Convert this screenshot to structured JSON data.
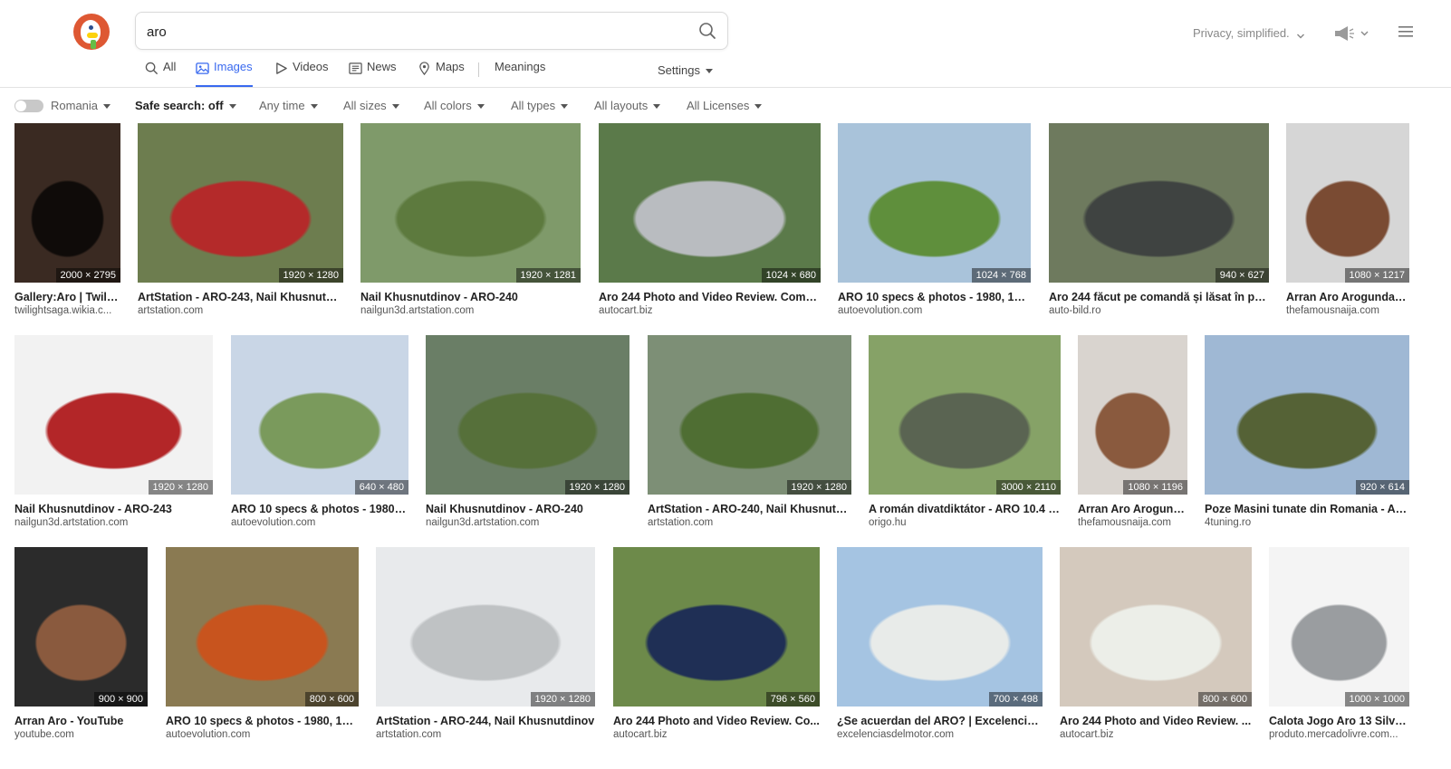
{
  "search": {
    "query": "aro"
  },
  "header": {
    "tagline": "Privacy, simplified."
  },
  "tabs": [
    {
      "label": "All",
      "icon": "search-icon"
    },
    {
      "label": "Images",
      "icon": "image-icon",
      "active": true
    },
    {
      "label": "Videos",
      "icon": "play-icon"
    },
    {
      "label": "News",
      "icon": "newspaper-icon"
    },
    {
      "label": "Maps",
      "icon": "map-pin-icon"
    },
    {
      "label": "Meanings"
    }
  ],
  "settings_label": "Settings",
  "filters": {
    "region": "Romania",
    "safe_search": "Safe search: off",
    "time": "Any time",
    "size": "All sizes",
    "color": "All colors",
    "type": "All types",
    "layout": "All layouts",
    "license": "All Licenses"
  },
  "colors": {
    "accent": "#3969ef",
    "logo": "#de5833"
  },
  "results": [
    {
      "title": "Gallery:Aro | Twilig...",
      "source": "twilightsaga.wikia.c...",
      "dims": "2000 × 2795",
      "colors": [
        "#3a2a22",
        "#0f0b09"
      ]
    },
    {
      "title": "ArtStation - ARO-243, Nail Khusnutdi...",
      "source": "artstation.com",
      "dims": "1920 × 1280",
      "colors": [
        "#6d7d4f",
        "#b42a2a"
      ]
    },
    {
      "title": "Nail Khusnutdinov - ARO-240",
      "source": "nailgun3d.artstation.com",
      "dims": "1920 × 1281",
      "colors": [
        "#7f9a6a",
        "#5d7a3e"
      ]
    },
    {
      "title": "Aro 244 Photo and Video Review. Comm...",
      "source": "autocart.biz",
      "dims": "1024 × 680",
      "colors": [
        "#5b7a4a",
        "#b9bcc0"
      ]
    },
    {
      "title": "ARO 10 specs & photos - 1980, 1981...",
      "source": "autoevolution.com",
      "dims": "1024 × 768",
      "colors": [
        "#a9c3da",
        "#5f8f3c"
      ]
    },
    {
      "title": "Aro 244 făcut pe comandă și lăsat în par...",
      "source": "auto-bild.ro",
      "dims": "940 × 627",
      "colors": [
        "#6e7a5e",
        "#3f4341"
      ]
    },
    {
      "title": "Arran Aro Arogundad...",
      "source": "thefamousnaija.com",
      "dims": "1080 × 1217",
      "colors": [
        "#d6d6d6",
        "#7a4b33"
      ]
    },
    {
      "title": "Nail Khusnutdinov - ARO-243",
      "source": "nailgun3d.artstation.com",
      "dims": "1920 × 1280",
      "colors": [
        "#f2f2f2",
        "#b32628"
      ]
    },
    {
      "title": "ARO 10 specs & photos - 1980, 1...",
      "source": "autoevolution.com",
      "dims": "640 × 480",
      "colors": [
        "#c9d6e6",
        "#7a9a5c"
      ]
    },
    {
      "title": "Nail Khusnutdinov - ARO-240",
      "source": "nailgun3d.artstation.com",
      "dims": "1920 × 1280",
      "colors": [
        "#6a7e66",
        "#56703a"
      ]
    },
    {
      "title": "ArtStation - ARO-240, Nail Khusnutdi...",
      "source": "artstation.com",
      "dims": "1920 × 1280",
      "colors": [
        "#7d8f76",
        "#4f6e33"
      ]
    },
    {
      "title": "A román divatdiktátor - ARO 10.4 v...",
      "source": "origo.hu",
      "dims": "3000 × 2110",
      "colors": [
        "#86a267",
        "#5a6452"
      ]
    },
    {
      "title": "Arran Aro Arogund...",
      "source": "thefamousnaija.com",
      "dims": "1080 × 1196",
      "colors": [
        "#d9d4cf",
        "#8a5a3e"
      ]
    },
    {
      "title": "Poze Masini tunate din Romania - Aro...",
      "source": "4tuning.ro",
      "dims": "920 × 614",
      "colors": [
        "#9fb8d4",
        "#556236"
      ]
    },
    {
      "title": "Arran Aro - YouTube",
      "source": "youtube.com",
      "dims": "900 × 900",
      "colors": [
        "#2b2b2b",
        "#8a5a3e"
      ]
    },
    {
      "title": "ARO 10 specs & photos - 1980, 198...",
      "source": "autoevolution.com",
      "dims": "800 × 600",
      "colors": [
        "#8a7a52",
        "#c8541e"
      ]
    },
    {
      "title": "ArtStation - ARO-244, Nail Khusnutdinov",
      "source": "artstation.com",
      "dims": "1920 × 1280",
      "colors": [
        "#e8eaec",
        "#bfc2c4"
      ]
    },
    {
      "title": "Aro 244 Photo and Video Review. Co...",
      "source": "autocart.biz",
      "dims": "796 × 560",
      "colors": [
        "#6d8a4a",
        "#1f2f55"
      ]
    },
    {
      "title": "¿Se acuerdan del ARO? | Excelencias ...",
      "source": "excelenciasdelmotor.com",
      "dims": "700 × 498",
      "colors": [
        "#a5c4e2",
        "#e8ebe9"
      ]
    },
    {
      "title": "Aro 244 Photo and Video Review. ...",
      "source": "autocart.biz",
      "dims": "800 × 600",
      "colors": [
        "#d4c9bd",
        "#eceee8"
      ]
    },
    {
      "title": "Calota Jogo Aro 13 Silver...",
      "source": "produto.mercadolivre.com...",
      "dims": "1000 × 1000",
      "colors": [
        "#f4f4f4",
        "#9a9da0"
      ]
    }
  ]
}
